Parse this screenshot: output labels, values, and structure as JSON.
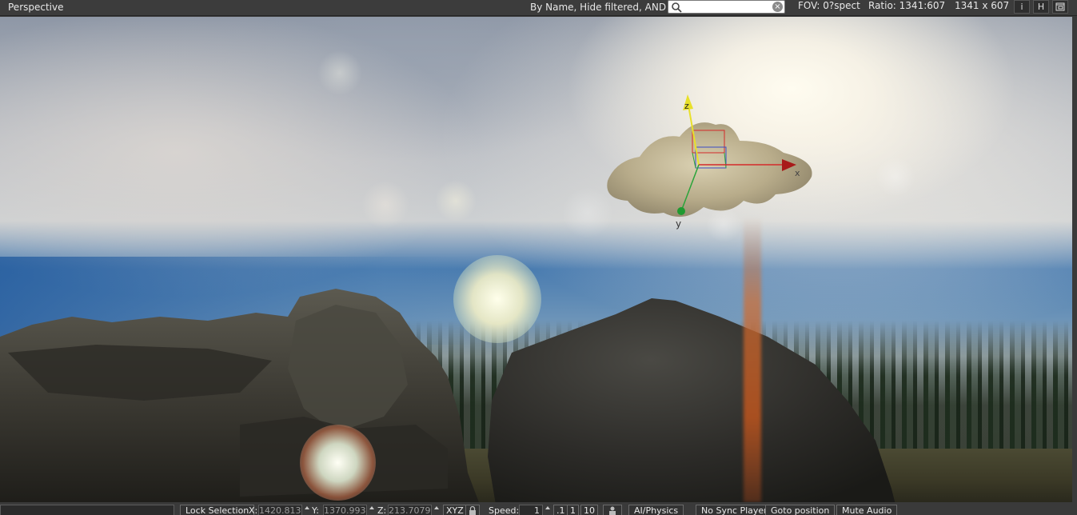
{
  "header": {
    "title": "Perspective",
    "filter_mode": "By Name, Hide filtered, AND",
    "search": {
      "value": "",
      "placeholder": ""
    },
    "fov": "FOV: 0?spect",
    "ratio": "Ratio: 1341:607",
    "resolution": "1341 x 607",
    "buttons": [
      {
        "label": "i",
        "icon": "info-icon"
      },
      {
        "label": "H",
        "icon": "help-icon"
      },
      {
        "label": "",
        "icon": "window-icon"
      }
    ]
  },
  "viewport": {
    "gizmo": {
      "axis_x_label": "x",
      "axis_y_label": "y",
      "axis_z_label": "z"
    },
    "colors": {
      "x_axis": "#d42a2a",
      "y_axis": "#2aa43a",
      "z_axis": "#e8e02a"
    }
  },
  "toolbar": {
    "lock_selection": "Lock Selection",
    "x_label": "X:",
    "x_value": "1420.813",
    "y_label": "Y:",
    "y_value": "1370.993",
    "z_label": "Z:",
    "z_value": "213.7079",
    "xyz": "XYZ",
    "speed_label": "Speed:",
    "speed_value": "1",
    "speed_presets": [
      ".1",
      "1",
      "10"
    ],
    "ai_physics": "AI/Physics",
    "no_sync_player": "No Sync Player",
    "goto_position": "Goto position",
    "mute_audio": "Mute Audio"
  }
}
